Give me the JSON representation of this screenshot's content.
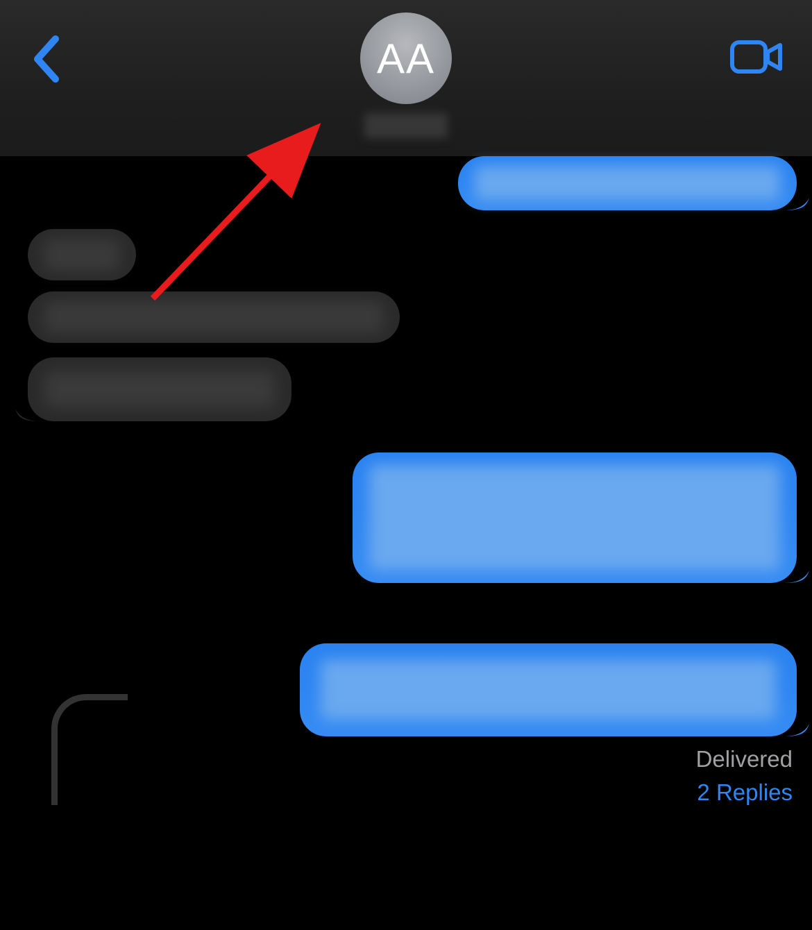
{
  "header": {
    "avatar_initials": "AA",
    "contact_name": "",
    "back_label": "Back",
    "video_label": "FaceTime"
  },
  "messages": {
    "m1": {
      "sender": "me",
      "text": ""
    },
    "m2": {
      "sender": "them",
      "text": ""
    },
    "m3": {
      "sender": "them",
      "text": ""
    },
    "m4": {
      "sender": "them",
      "text": ""
    },
    "m5": {
      "sender": "me",
      "text": ""
    },
    "m6": {
      "sender": "me",
      "text": ""
    }
  },
  "status": {
    "delivered_label": "Delivered",
    "replies_label": "2 Replies"
  },
  "annotation": {
    "type": "arrow",
    "color": "#ff0000",
    "description": "red arrow pointing to contact name under avatar"
  },
  "colors": {
    "sent_bubble": "#2f86f2",
    "received_bubble": "#2a2a2b",
    "link": "#2f86f2",
    "status": "#a0a1a3"
  }
}
